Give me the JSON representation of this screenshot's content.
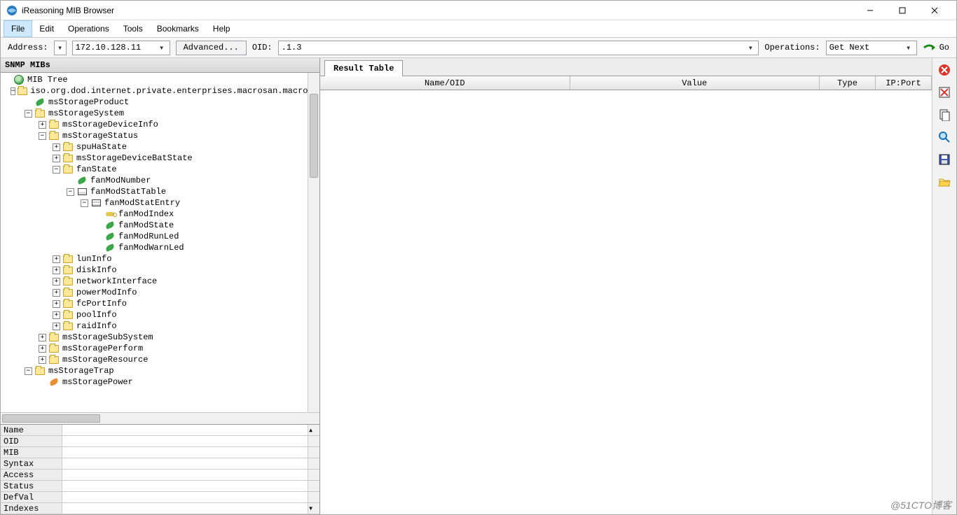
{
  "window": {
    "title": "iReasoning MIB Browser"
  },
  "menu": {
    "file": "File",
    "edit": "Edit",
    "operations": "Operations",
    "tools": "Tools",
    "bookmarks": "Bookmarks",
    "help": "Help"
  },
  "toolbar": {
    "address_label": "Address:",
    "address_value": "172.10.128.11",
    "advanced_label": "Advanced...",
    "oid_label": "OID:",
    "oid_value": ".1.3",
    "operations_label": "Operations:",
    "operations_value": "Get Next",
    "go_label": "Go"
  },
  "left": {
    "header": "SNMP MIBs",
    "root": "MIB Tree",
    "path": "iso.org.dod.internet.private.enterprises.macrosan.macrosanStorage",
    "n_msStorageProduct": "msStorageProduct",
    "n_msStorageSystem": "msStorageSystem",
    "n_msStorageDeviceInfo": "msStorageDeviceInfo",
    "n_msStorageStatus": "msStorageStatus",
    "n_spuHaState": "spuHaState",
    "n_msStorageDeviceBatState": "msStorageDeviceBatState",
    "n_fanState": "fanState",
    "n_fanModNumber": "fanModNumber",
    "n_fanModStatTable": "fanModStatTable",
    "n_fanModStatEntry": "fanModStatEntry",
    "n_fanModIndex": "fanModIndex",
    "n_fanModState": "fanModState",
    "n_fanModRunLed": "fanModRunLed",
    "n_fanModWarnLed": "fanModWarnLed",
    "n_lunInfo": "lunInfo",
    "n_diskInfo": "diskInfo",
    "n_networkInterface": "networkInterface",
    "n_powerModInfo": "powerModInfo",
    "n_fcPortInfo": "fcPortInfo",
    "n_poolInfo": "poolInfo",
    "n_raidInfo": "raidInfo",
    "n_msStorageSubSystem": "msStorageSubSystem",
    "n_msStoragePerform": "msStoragePerform",
    "n_msStorageResource": "msStorageResource",
    "n_msStorageTrap": "msStorageTrap",
    "n_msStoragePower": "msStoragePower"
  },
  "props": {
    "k_name": "Name",
    "k_oid": "OID",
    "k_mib": "MIB",
    "k_syntax": "Syntax",
    "k_access": "Access",
    "k_status": "Status",
    "k_defval": "DefVal",
    "k_indexes": "Indexes"
  },
  "result": {
    "tab": "Result Table",
    "col_name": "Name/OID",
    "col_value": "Value",
    "col_type": "Type",
    "col_ipport": "IP:Port"
  },
  "watermark": "@51CTO博客"
}
